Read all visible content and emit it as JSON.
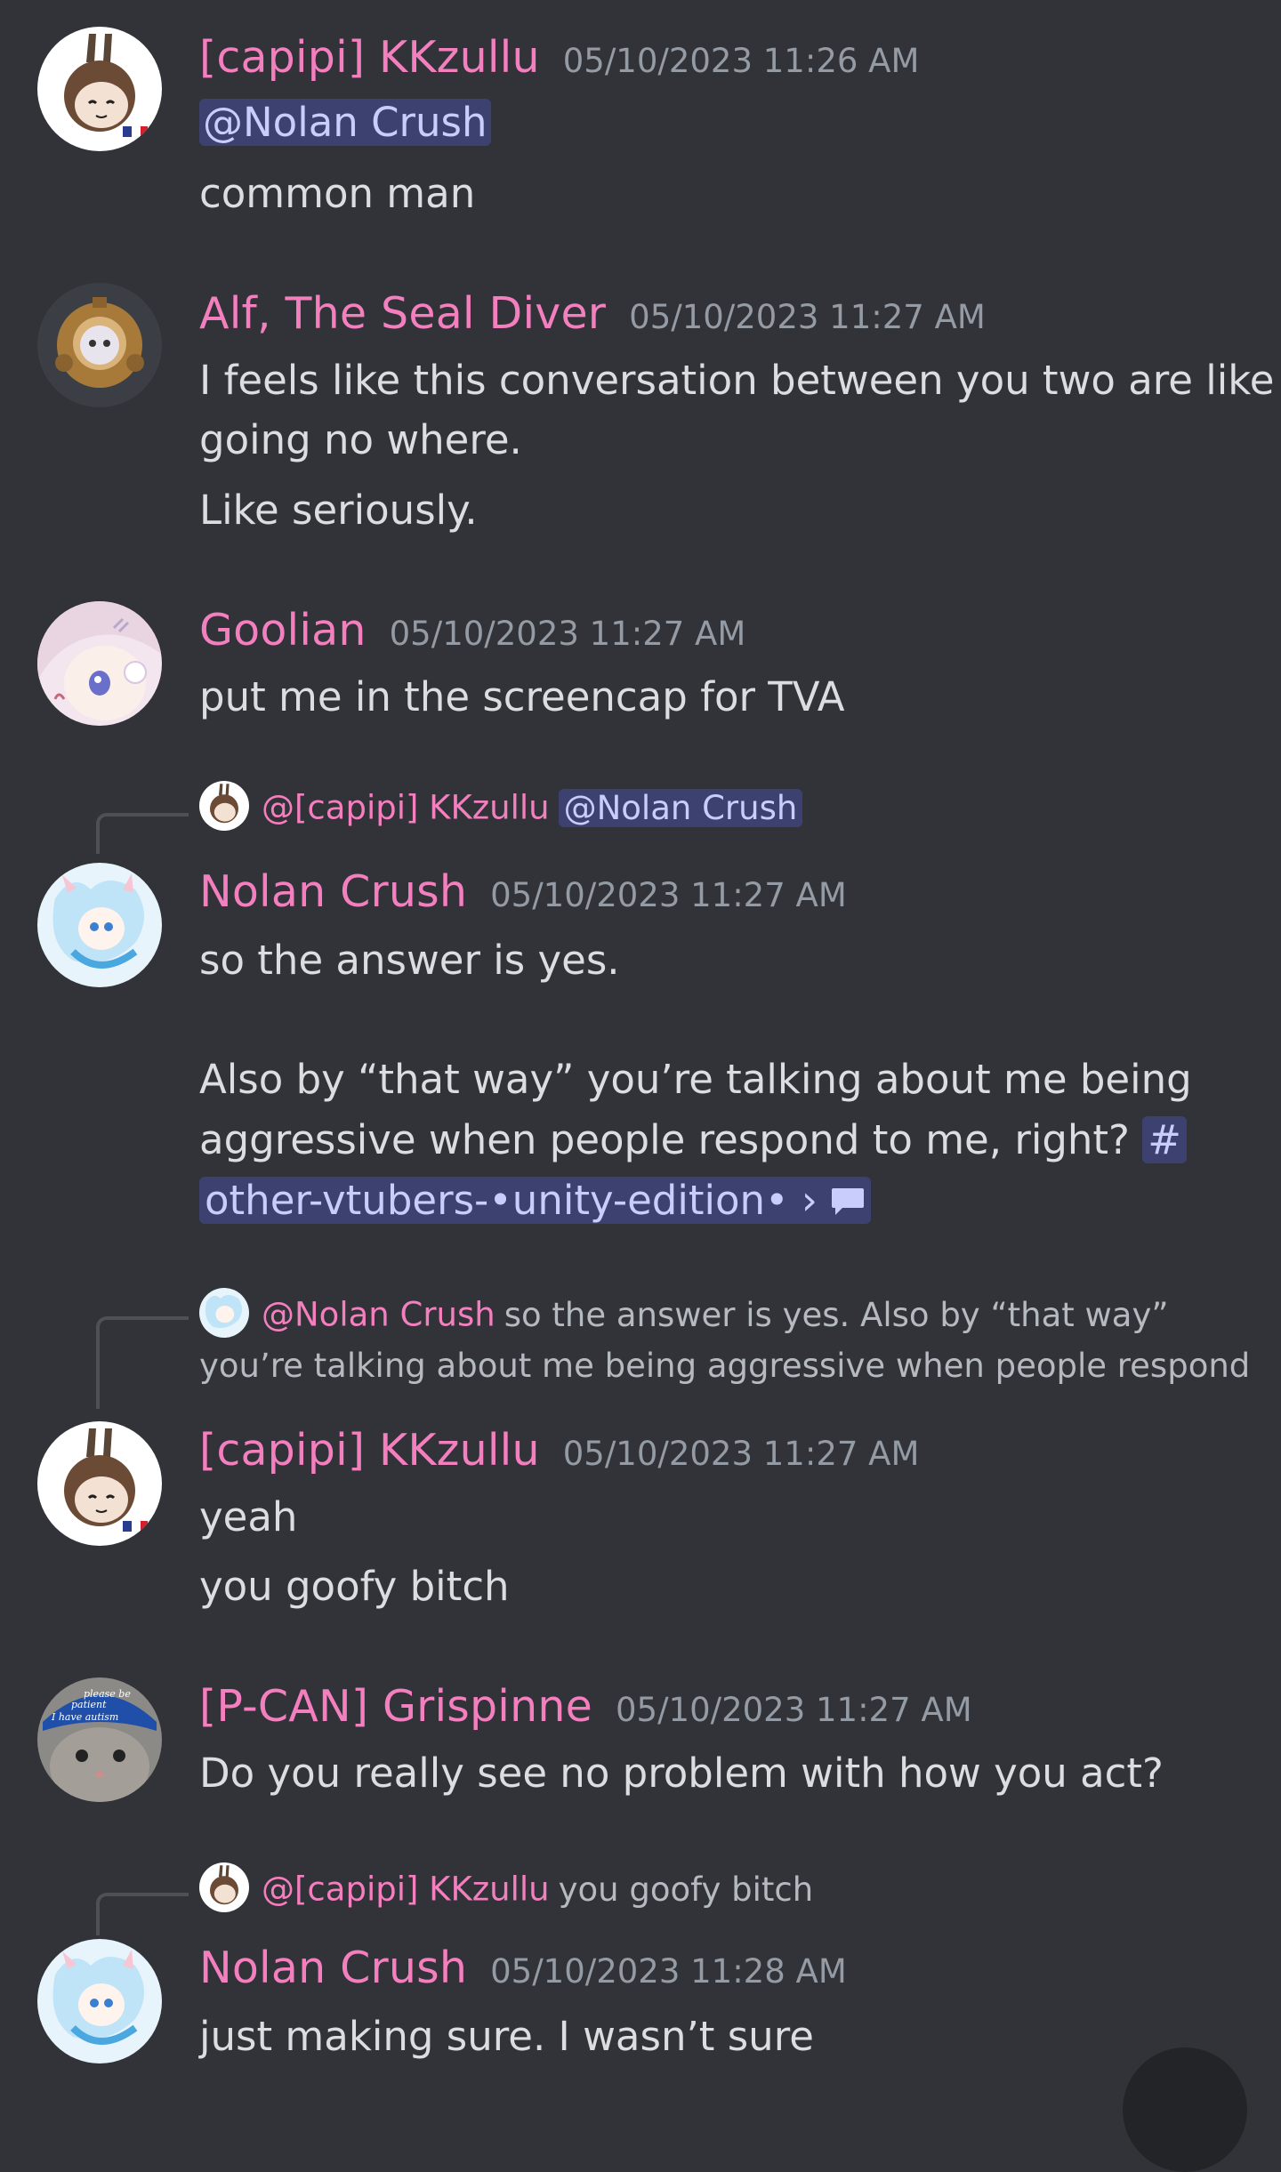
{
  "messages": [
    {
      "author": "[capipi] KKzullu",
      "timestamp": "05/10/2023 11:26 AM",
      "mention": "@Nolan Crush",
      "lines": [
        "common man"
      ]
    },
    {
      "author": "Alf, The Seal Diver",
      "timestamp": "05/10/2023 11:27 AM",
      "lines": [
        "I feels like this conversation between you two are like",
        "going no where.",
        "Like seriously."
      ]
    },
    {
      "author": "Goolian",
      "timestamp": "05/10/2023 11:27 AM",
      "lines": [
        "put me in the screencap for TVA"
      ]
    },
    {
      "reply": {
        "author": "@[capipi] KKzullu",
        "mention": "@Nolan Crush"
      },
      "author": "Nolan Crush",
      "timestamp": "05/10/2023 11:27 AM",
      "lines": [
        "so the answer is yes.",
        "Also  by “that way” you’re talking about me being",
        "aggressive when people respond to me, right?"
      ],
      "channel_hash": "#",
      "channel_name": "other-vtubers-•unity-edition•",
      "channel_chevron": "›"
    },
    {
      "reply": {
        "author": "@Nolan Crush",
        "text": "so the answer is yes.  Also  by “that way”",
        "text2": "you’re talking about me being aggressive when people respond"
      },
      "author": "[capipi] KKzullu",
      "timestamp": "05/10/2023 11:27 AM",
      "lines": [
        "yeah",
        "you goofy bitch"
      ]
    },
    {
      "author": "[P-CAN] Grispinne",
      "timestamp": "05/10/2023 11:27 AM",
      "avatar_text": [
        "please be",
        "patient",
        "I have autism"
      ],
      "lines": [
        "Do you really see no problem with how you act?"
      ]
    },
    {
      "reply": {
        "author": "@[capipi] KKzullu",
        "text": "you goofy bitch"
      },
      "author": "Nolan Crush",
      "timestamp": "05/10/2023 11:28 AM",
      "lines": [
        "just making sure. I wasn’t sure"
      ]
    }
  ],
  "colors": {
    "background": "#313338",
    "username": "#f47fbf",
    "timestamp": "#949ba4",
    "text": "#dbdee1",
    "mention_bg": "#414774",
    "mention_text": "#c9cdfb"
  }
}
